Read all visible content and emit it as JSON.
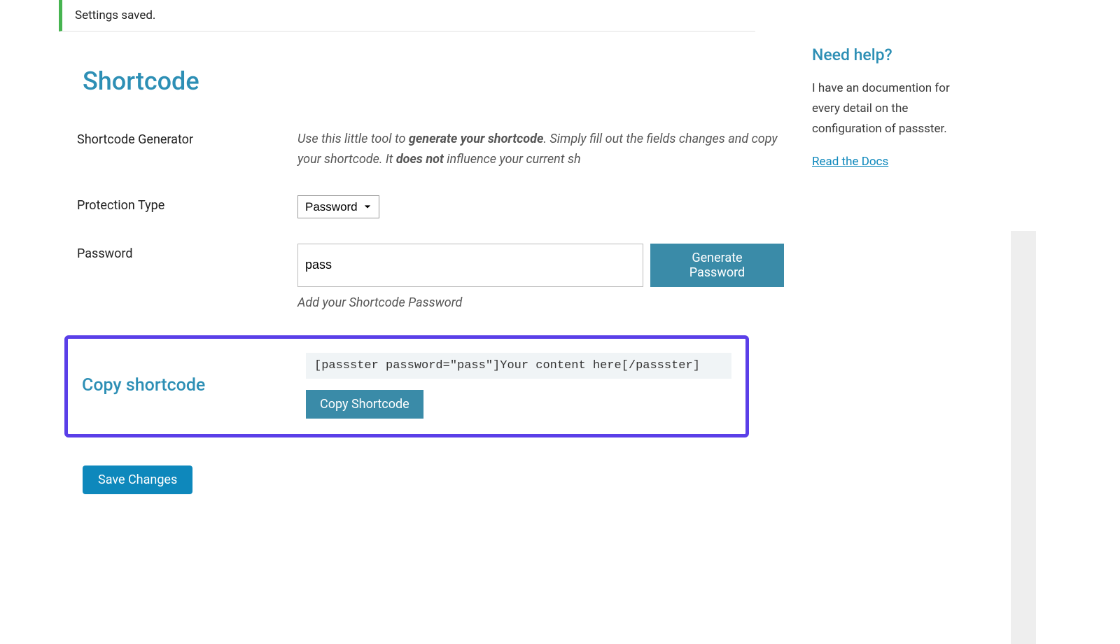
{
  "notice": {
    "message": "Settings saved."
  },
  "section": {
    "title": "Shortcode"
  },
  "fields": {
    "generator": {
      "label": "Shortcode Generator",
      "desc_pre": "Use this little tool to ",
      "desc_strong1": "generate your shortcode",
      "desc_mid": ". Simply fill out the fields changes and copy your shortcode. It ",
      "desc_strong2": "does not",
      "desc_post": " influence your current sh"
    },
    "protection": {
      "label": "Protection Type",
      "value": "Password"
    },
    "password": {
      "label": "Password",
      "value": "pass",
      "button": "Generate Password",
      "help": "Add your Shortcode Password"
    }
  },
  "highlight": {
    "label": "Copy shortcode",
    "code": "[passster password=\"pass\"]Your content here[/passster]",
    "button": "Copy Shortcode"
  },
  "save": {
    "button": "Save Changes"
  },
  "sidebar": {
    "title": "Need help?",
    "text": "I have an documention for every detail on the configuration of passster.",
    "link": "Read the Docs"
  }
}
